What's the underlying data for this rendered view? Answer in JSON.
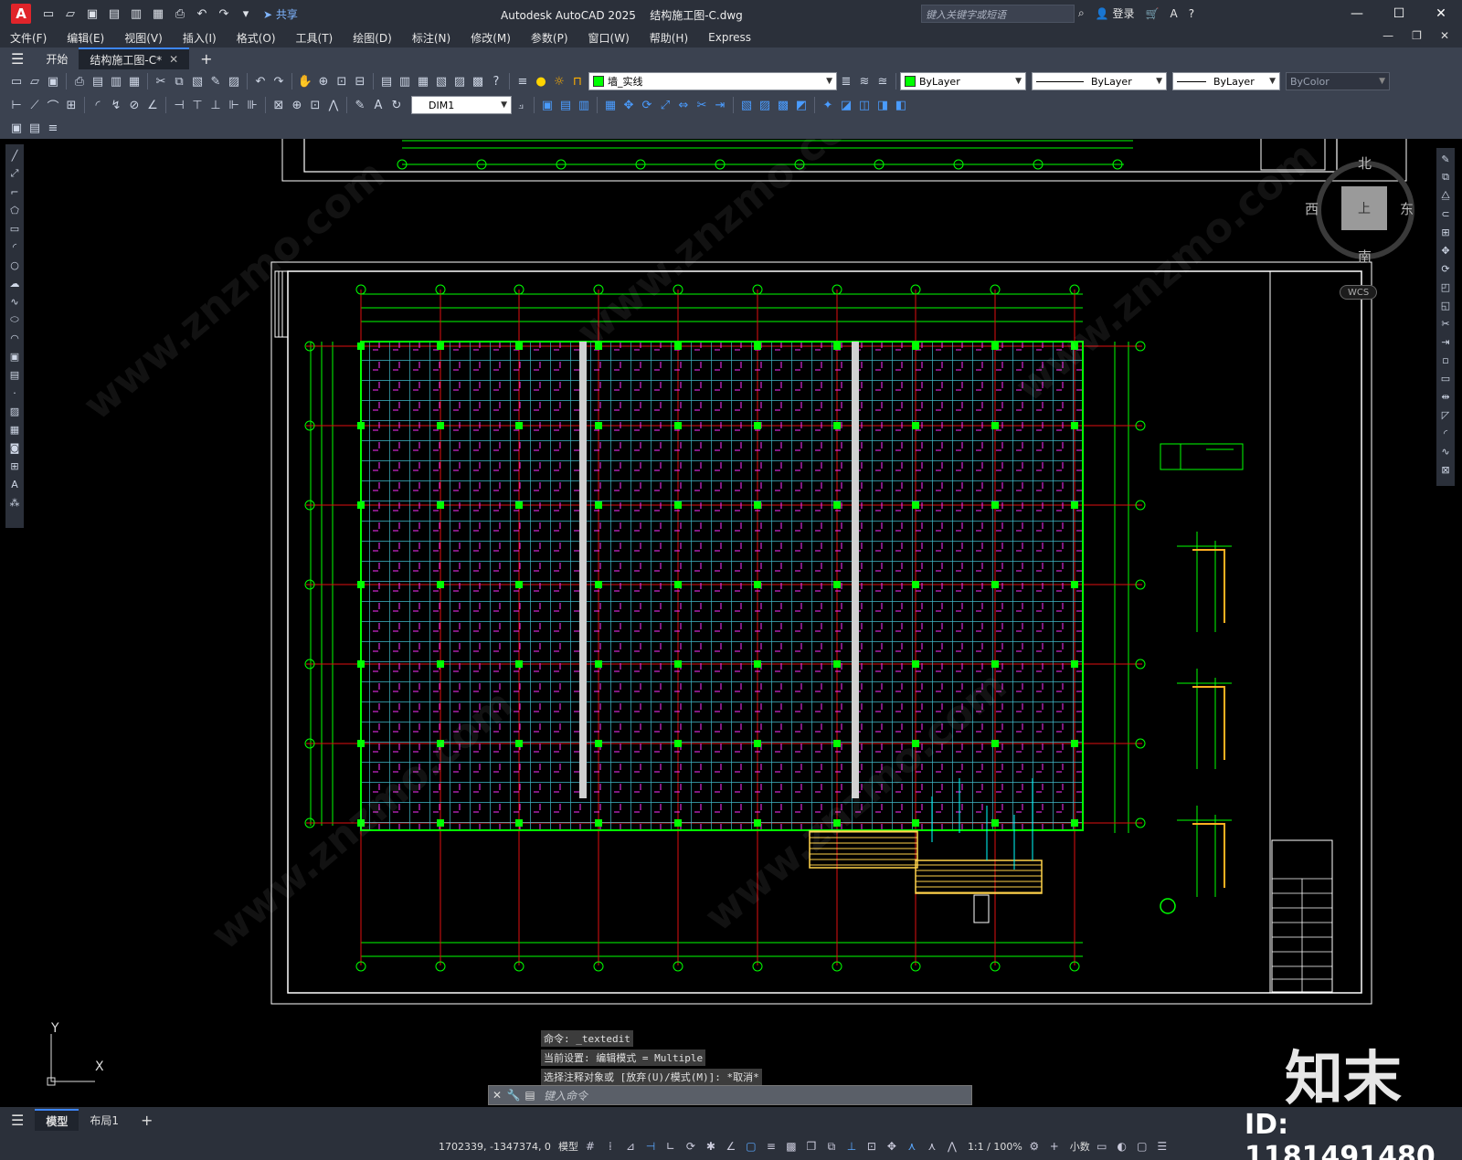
{
  "titlebar": {
    "logo_letter": "A",
    "share_label": "共享",
    "app_title": "Autodesk AutoCAD 2025",
    "file_title": "结构施工图-C.dwg",
    "search_placeholder": "键入关键字或短语",
    "login_label": "登录"
  },
  "menubar": {
    "items": [
      "文件(F)",
      "编辑(E)",
      "视图(V)",
      "插入(I)",
      "格式(O)",
      "工具(T)",
      "绘图(D)",
      "标注(N)",
      "修改(M)",
      "参数(P)",
      "窗口(W)",
      "帮助(H)",
      "Express"
    ]
  },
  "tabs": {
    "start": "开始",
    "drawing": "结构施工图-C*"
  },
  "properties": {
    "layer": "墙_实线",
    "color": "ByLayer",
    "linetype": "ByLayer",
    "lineweight": "ByLayer",
    "plotstyle": "ByColor",
    "dimstyle": "DIM1",
    "layer_color": "#00ff00"
  },
  "viewcube": {
    "north": "北",
    "south": "南",
    "east": "东",
    "west": "西",
    "face": "上",
    "wcs": "WCS"
  },
  "ucs": {
    "y": "Y",
    "x": "X"
  },
  "command": {
    "history": [
      "命令: _textedit",
      "当前设置: 编辑模式 = Multiple",
      "选择注释对象或 [放弃(U)/模式(M)]: *取消*"
    ],
    "placeholder": "键入命令"
  },
  "layouts": {
    "model": "模型",
    "layout1": "布局1"
  },
  "statusbar": {
    "coords": "1702339, -1347374, 0",
    "model_label": "模型",
    "scale": "1:1 / 100%",
    "units": "小数"
  },
  "watermark": {
    "logo": "知末",
    "id": "ID: 1181491480",
    "site": "www.znzmo.com"
  }
}
